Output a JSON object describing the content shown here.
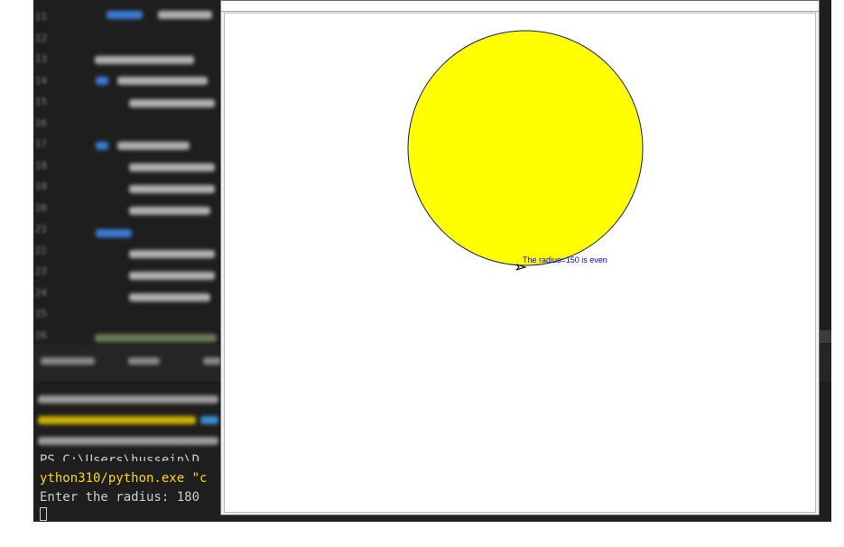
{
  "turtle_window": {
    "title": "",
    "canvas_label": "The radius=150 is even",
    "circle_fill": "#ffff00",
    "label_color": "#0000ff"
  },
  "editor": {
    "line_numbers": [
      "11",
      "12",
      "13",
      "14",
      "15",
      "16",
      "17",
      "18",
      "19",
      "20",
      "21",
      "22",
      "23",
      "24",
      "25",
      "26"
    ]
  },
  "terminal": {
    "lines": [
      "PS C:\\Users\\hussein\\D",
      "ython310/python.exe \"c",
      "Enter the radius: 180"
    ]
  },
  "colors": {
    "editor_bg": "#1e1e1e",
    "terminal_path": "#ffd700",
    "terminal_text": "#cccccc"
  }
}
